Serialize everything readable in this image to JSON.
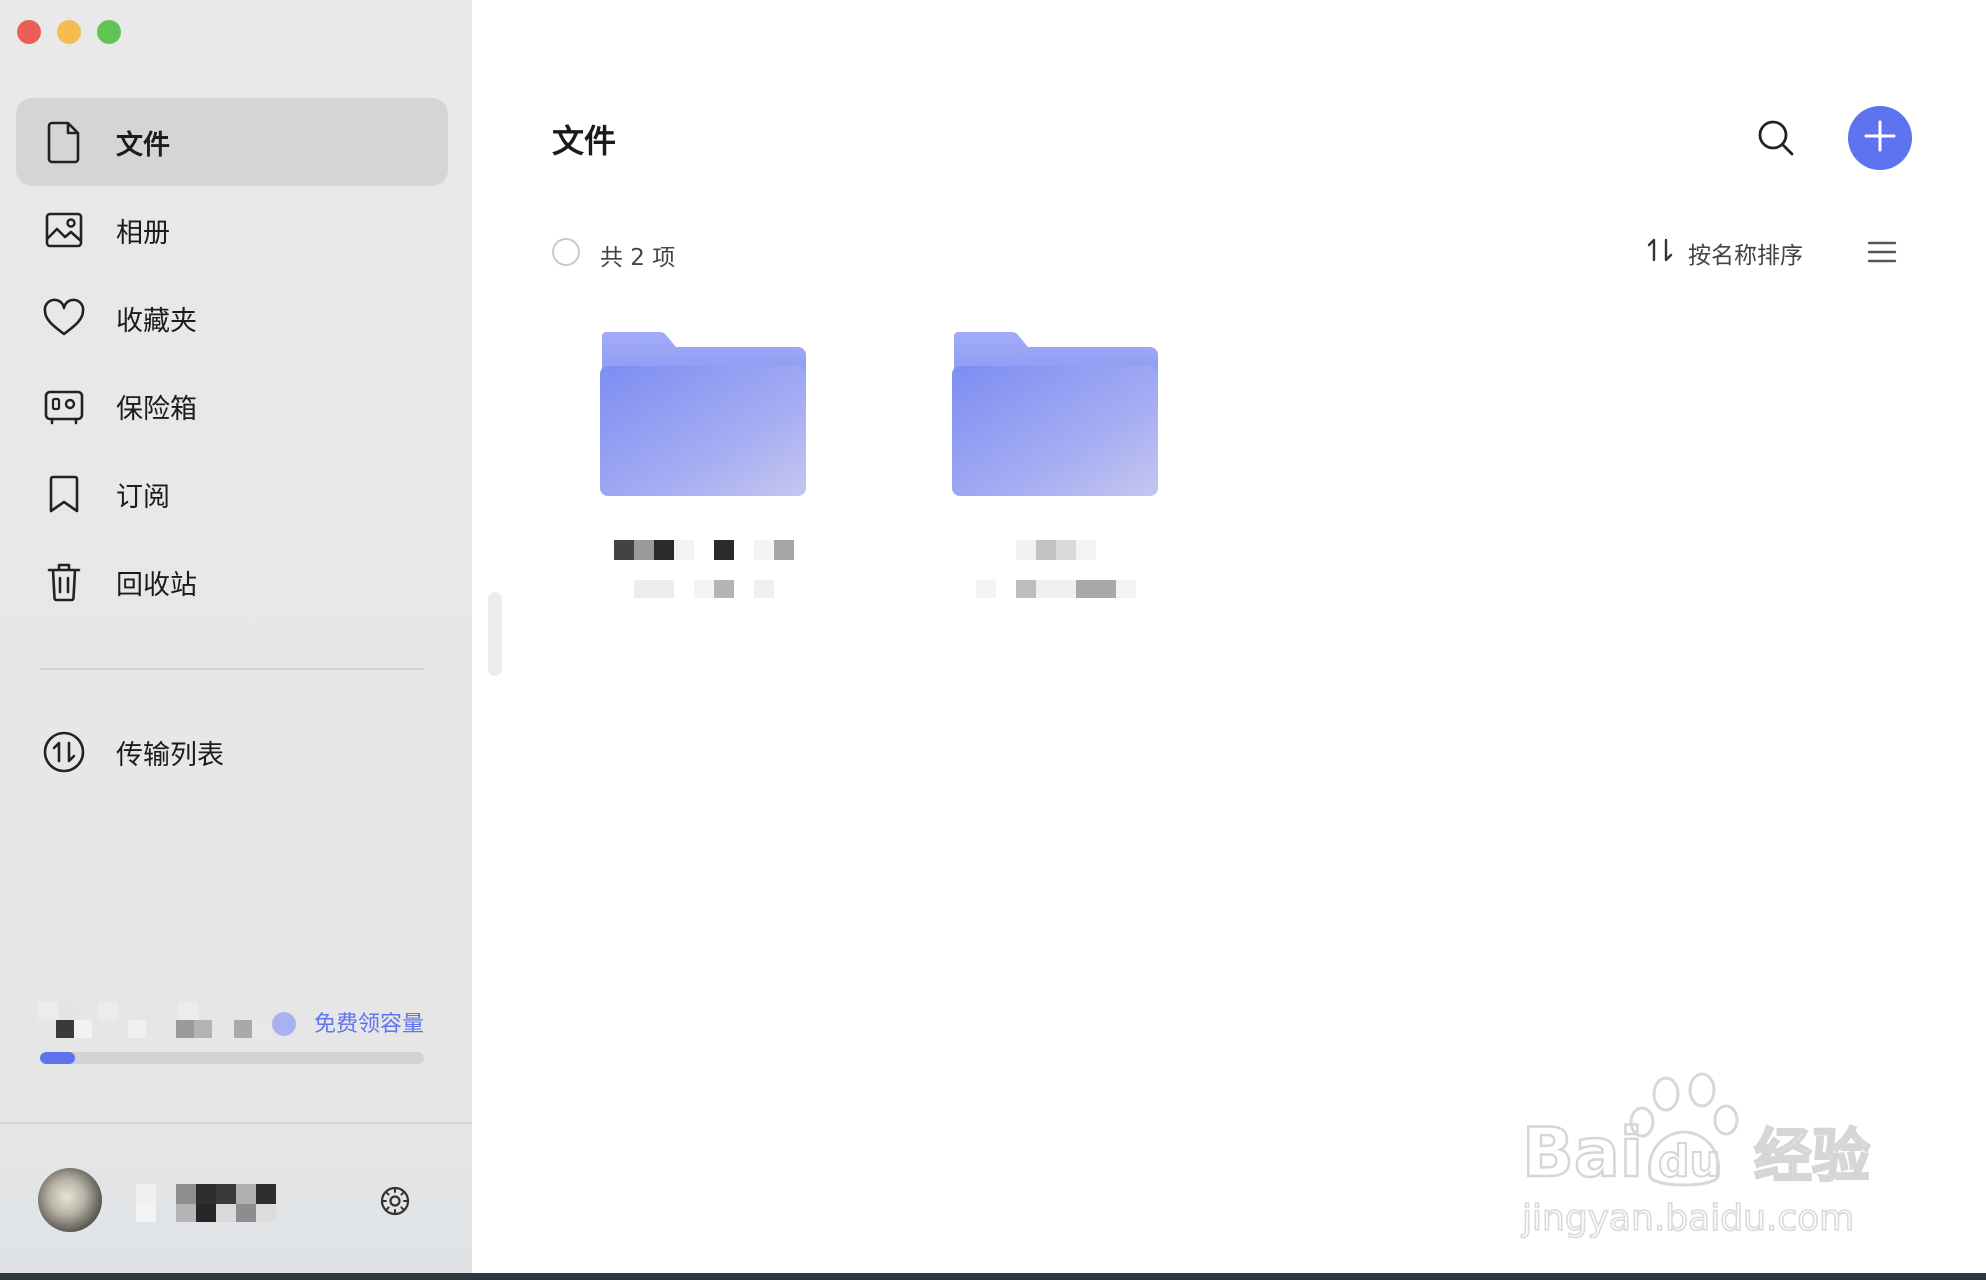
{
  "window": {
    "traffic_lights": {
      "close_color": "#ec5f57",
      "minimize_color": "#f4bd4f",
      "maximize_color": "#5fc454"
    }
  },
  "sidebar": {
    "items": [
      {
        "label": "文件",
        "icon": "file-icon",
        "active": true
      },
      {
        "label": "相册",
        "icon": "photo-album-icon",
        "active": false
      },
      {
        "label": "收藏夹",
        "icon": "heart-icon",
        "active": false
      },
      {
        "label": "保险箱",
        "icon": "safe-icon",
        "active": false
      },
      {
        "label": "订阅",
        "icon": "bookmark-icon",
        "active": false
      },
      {
        "label": "回收站",
        "icon": "trash-icon",
        "active": false
      }
    ],
    "transfer": {
      "label": "传输列表",
      "icon": "transfer-icon"
    },
    "storage": {
      "claim_label": "免费领容量",
      "used_fraction": 0.09,
      "accent": "#5f73ee"
    },
    "settings_icon": "gear-icon"
  },
  "main": {
    "title": "文件",
    "search_icon": "search-icon",
    "add_icon": "plus-icon",
    "add_color": "#5d73f0",
    "count_label": "共 2 项",
    "sort_label": "按名称排序",
    "sort_icon": "sort-arrows-icon",
    "view_icon": "list-view-icon",
    "folder_count": 2
  },
  "watermark": {
    "brand": "Bai du 经验",
    "url": "jingyan.baidu.com"
  }
}
